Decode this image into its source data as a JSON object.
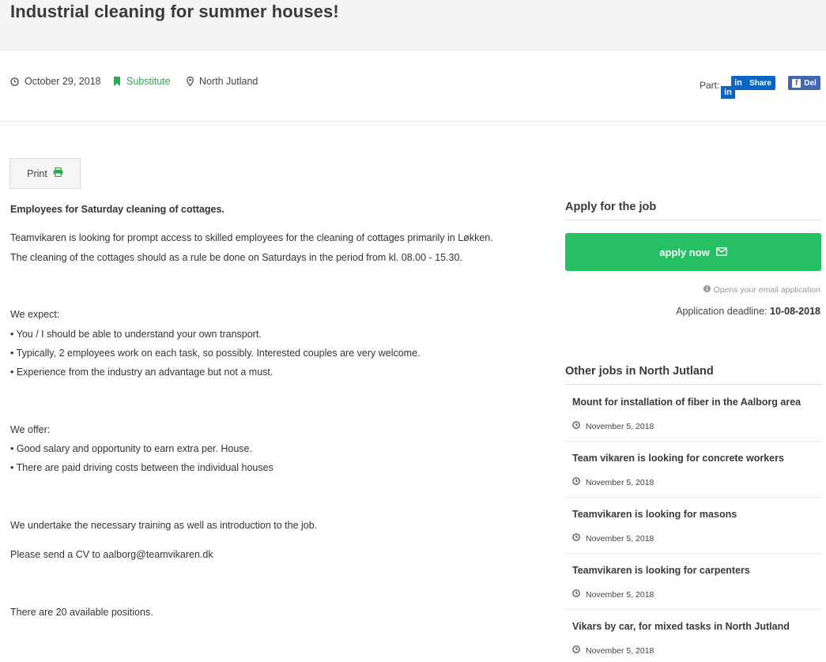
{
  "page": {
    "title": "Industrial cleaning for summer houses!"
  },
  "meta": {
    "date": "October 29, 2018",
    "type": "Substitute",
    "location": "North Jutland",
    "share_label": "Part:",
    "linkedin_label": "Share",
    "facebook_label": "Del"
  },
  "print": {
    "label": "Print"
  },
  "description": {
    "heading": "Employees for Saturday cleaning of cottages.",
    "intro_1": "Teamvikaren is looking for prompt access to skilled employees for the cleaning of cottages primarily in Løkken.",
    "intro_2": "The cleaning of the cottages should as a rule be done on Saturdays in the period from kl. 08.00 - 15.30.",
    "expect_heading": "We expect:",
    "expect_items": [
      "• You / I should be able to understand your own transport.",
      "• Typically, 2 employees work on each task, so possibly. Interested couples are very welcome.",
      "• Experience from the industry an advantage but not a must."
    ],
    "offer_heading": "We offer:",
    "offer_items": [
      "• Good salary and opportunity to earn extra per. House.",
      "• There are paid driving costs between the individual houses"
    ],
    "training": "We undertake the necessary training as well as introduction to the job.",
    "cv": "Please send a CV to aalborg@teamvikaren.dk",
    "positions": "There are 20 available positions."
  },
  "apply": {
    "heading": "Apply for the job",
    "button_label": "apply now",
    "note": "Opens your email application",
    "deadline_label": "Application deadline:",
    "deadline_value": "10-08-2018"
  },
  "other_jobs": {
    "heading": "Other jobs in North Jutland",
    "items": [
      {
        "title": "Mount for installation of fiber in the Aalborg area",
        "date": "November 5, 2018"
      },
      {
        "title": "Team vikaren is looking for concrete workers",
        "date": "November 5, 2018"
      },
      {
        "title": "Teamvikaren is looking for masons",
        "date": "November 5, 2018"
      },
      {
        "title": "Teamvikaren is looking for carpenters",
        "date": "November 5, 2018"
      },
      {
        "title": "Vikars by car, for mixed tasks in North Jutland",
        "date": "November 5, 2018"
      }
    ]
  },
  "colors": {
    "accent_green": "#27bf63",
    "label_green": "#2fa84f",
    "linkedin_blue": "#0a66c2",
    "facebook_blue": "#4267b2"
  },
  "icons": {
    "date": "clock-icon",
    "type": "bookmark-icon",
    "location": "map-pin-icon",
    "print": "printer-icon",
    "apply": "envelope-icon",
    "note": "info-icon"
  }
}
